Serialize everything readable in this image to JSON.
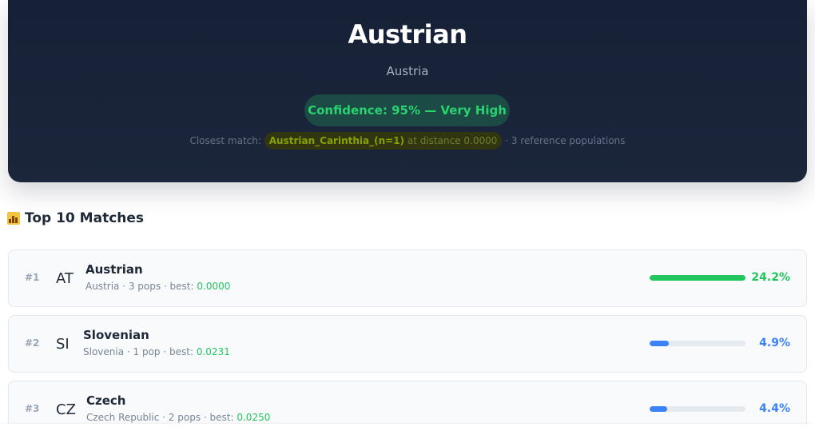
{
  "result": {
    "title": "Austrian",
    "country": "Austria",
    "confidence_label": "Confidence: 95% — Very High",
    "closest_prefix": "Closest match:",
    "closest_name": "Austrian_Carinthia_(n=1)",
    "closest_mid": "at distance",
    "closest_distance": "0.0000",
    "closest_suffix": "· 3 reference populations"
  },
  "section": {
    "icon": "bar-chart-icon",
    "title": "Top 10 Matches"
  },
  "matches": [
    {
      "rank": "#1",
      "code": "AT",
      "name": "Austrian",
      "meta": "Austria · 3 pops · best:",
      "best": "0.0000",
      "percent_label": "24.2%",
      "bar_fraction": 1.0,
      "color": "#22c55e"
    },
    {
      "rank": "#2",
      "code": "SI",
      "name": "Slovenian",
      "meta": "Slovenia · 1 pop · best:",
      "best": "0.0231",
      "percent_label": "4.9%",
      "bar_fraction": 0.2,
      "color": "#3b82f6"
    },
    {
      "rank": "#3",
      "code": "CZ",
      "name": "Czech",
      "meta": "Czech Republic · 2 pops · best:",
      "best": "0.0250",
      "percent_label": "4.4%",
      "bar_fraction": 0.18,
      "color": "#3b82f6"
    }
  ]
}
